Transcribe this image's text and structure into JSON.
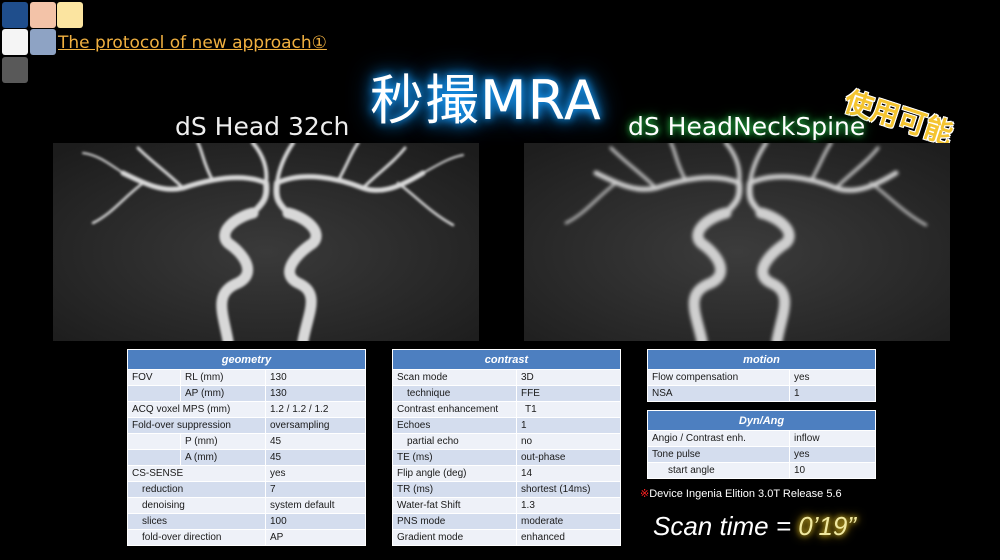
{
  "header": {
    "link_text": "The protocol of new approach①",
    "main_title": "秒撮MRA",
    "badge": "使用可能",
    "left_coil": "dS Head 32ch",
    "right_coil": "dS HeadNeckSpine"
  },
  "colors": {
    "swatches": [
      "#1f4e8c",
      "#f3c3a8",
      "#fbe4a0",
      "#f5f5f5",
      "#8ea3c4",
      "#595959"
    ],
    "title_glow": "#19a0ff",
    "coil_glow": "#28c24a",
    "table_header": "#4d7fc0",
    "link": "#f0b040",
    "scan_value_glow": "#f4d430"
  },
  "images": {
    "left_alt": "MRA image dS Head 32ch",
    "right_alt": "MRA image dS HeadNeckSpine"
  },
  "geometry": {
    "title": "geometry",
    "rows": [
      {
        "label": "FOV",
        "sub": "RL (mm)",
        "value": "130"
      },
      {
        "label": "",
        "sub": "AP (mm)",
        "value": "130"
      },
      {
        "label": "ACQ voxel MPS (mm)",
        "sub": "",
        "value": "1.2 / 1.2 / 1.2"
      },
      {
        "label": "Fold-over suppression",
        "sub": "",
        "value": "oversampling"
      },
      {
        "label": "",
        "sub": "P (mm)",
        "value": "45"
      },
      {
        "label": "",
        "sub": "A (mm)",
        "value": "45"
      },
      {
        "label": "CS-SENSE",
        "sub": "",
        "value": "yes"
      },
      {
        "label": "reduction",
        "sub": "",
        "value": "7"
      },
      {
        "label": "denoising",
        "sub": "",
        "value": "system default"
      },
      {
        "label": "slices",
        "sub": "",
        "value": "100"
      },
      {
        "label": "fold-over direction",
        "sub": "",
        "value": "AP"
      }
    ]
  },
  "contrast": {
    "title": "contrast",
    "rows": [
      {
        "label": "Scan mode",
        "value": "3D"
      },
      {
        "label": "technique",
        "value": "FFE"
      },
      {
        "label": "Contrast enhancement",
        "value": "T1"
      },
      {
        "label": "Echoes",
        "value": "1"
      },
      {
        "label": "partial echo",
        "value": "no"
      },
      {
        "label": "TE (ms)",
        "value": "out-phase"
      },
      {
        "label": "Flip angle (deg)",
        "value": "14"
      },
      {
        "label": "TR (ms)",
        "value": "shortest (14ms)"
      },
      {
        "label": "Water-fat Shift",
        "value": "1.3"
      },
      {
        "label": "PNS mode",
        "value": "moderate"
      },
      {
        "label": "Gradient mode",
        "value": "enhanced"
      }
    ]
  },
  "motion": {
    "title": "motion",
    "rows": [
      {
        "label": "Flow compensation",
        "value": "yes"
      },
      {
        "label": "NSA",
        "value": "1"
      }
    ]
  },
  "dynang": {
    "title": "Dyn/Ang",
    "rows": [
      {
        "label": "Angio / Contrast enh.",
        "value": "inflow"
      },
      {
        "label": "Tone pulse",
        "value": "yes"
      },
      {
        "label": "start angle",
        "value": "10"
      }
    ]
  },
  "footer": {
    "device_mark": "※",
    "device_text": "Device  Ingenia Elition 3.0T Release 5.6",
    "scan_label": "Scan time = ",
    "scan_value": "0’19”"
  }
}
